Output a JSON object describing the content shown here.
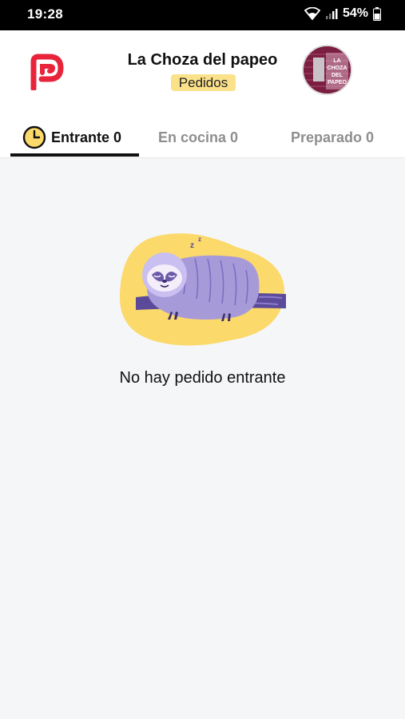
{
  "status_bar": {
    "time": "19:28",
    "battery": "54%",
    "icons": [
      "wifi-icon",
      "signal-icon",
      "battery-icon"
    ]
  },
  "header": {
    "logo": "app-logo-icon",
    "restaurant_name": "La Choza del papeo",
    "section_label": "Pedidos",
    "avatar_text": "LA CHOZA DEL PAPEO"
  },
  "tabs": [
    {
      "label": "Entrante 0",
      "active": true,
      "icon": "clock-icon"
    },
    {
      "label": "En cocina 0",
      "active": false
    },
    {
      "label": "Preparado 0",
      "active": false
    }
  ],
  "empty_state": {
    "illustration": "sleeping-sloth-icon",
    "message": "No hay pedido entrante"
  },
  "colors": {
    "brand_red": "#e8243b",
    "badge_yellow": "#fbe28a",
    "blob_yellow": "#fbd96a",
    "sloth_purple": "#a79ad8",
    "branch_purple": "#5b4a99"
  }
}
